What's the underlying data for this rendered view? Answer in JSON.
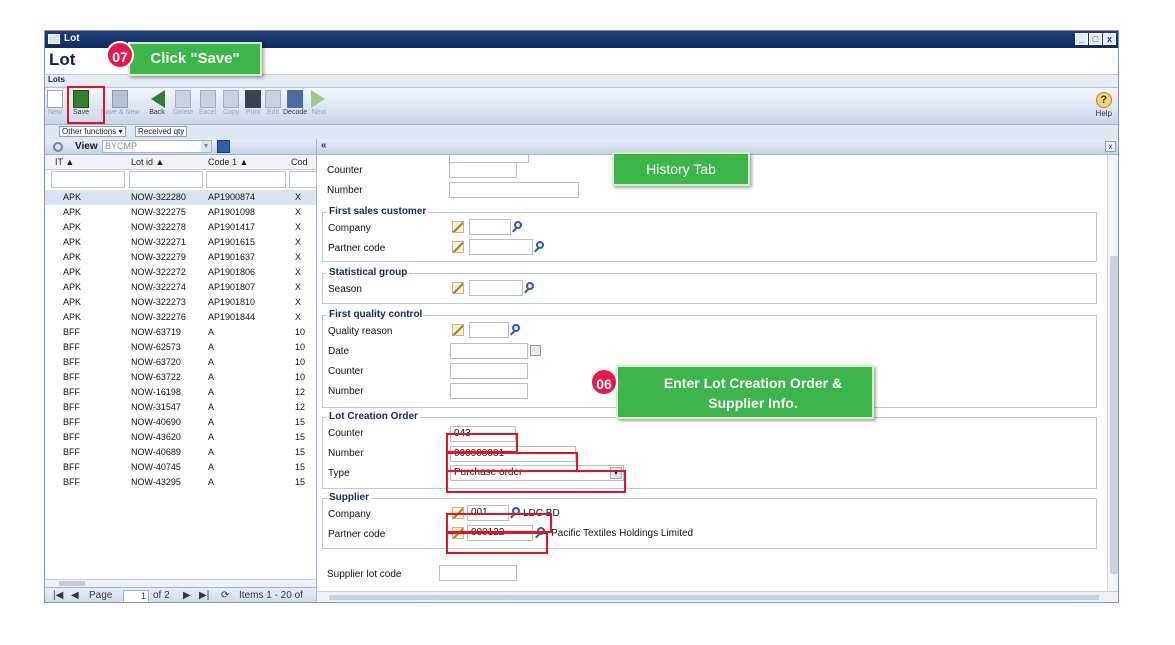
{
  "window": {
    "title": "Lot",
    "header": "Lot",
    "subheader": "Lots",
    "controls": [
      "_",
      "□",
      "x"
    ]
  },
  "toolbar": {
    "new": "New",
    "save": "Save",
    "save_new": "Save & New",
    "back": "Back",
    "delete": "Delete",
    "excel": "Excel",
    "copy": "Copy",
    "print": "Print",
    "edit": "Edit",
    "decode": "Decode",
    "next": "Next",
    "help": "Help"
  },
  "subtoolbar": {
    "other_functions": "Other functions ▾",
    "received_qty": "Received qty"
  },
  "grid": {
    "view_label": "View",
    "view_value": "BYCMP",
    "columns": [
      "IT ▲",
      "Lot id ▲",
      "Code 1 ▲",
      "Cod"
    ],
    "rows": [
      [
        "APK",
        "NOW-322280",
        "AP1900874",
        "X"
      ],
      [
        "APK",
        "NOW-322275",
        "AP1901098",
        "X"
      ],
      [
        "APK",
        "NOW-322278",
        "AP1901417",
        "X"
      ],
      [
        "APK",
        "NOW-322271",
        "AP1901615",
        "X"
      ],
      [
        "APK",
        "NOW-322279",
        "AP1901637",
        "X"
      ],
      [
        "APK",
        "NOW-322272",
        "AP1901806",
        "X"
      ],
      [
        "APK",
        "NOW-322274",
        "AP1901807",
        "X"
      ],
      [
        "APK",
        "NOW-322273",
        "AP1901810",
        "X"
      ],
      [
        "APK",
        "NOW-322276",
        "AP1901844",
        "X"
      ],
      [
        "BFF",
        "NOW-63719",
        "A",
        "10"
      ],
      [
        "BFF",
        "NOW-62573",
        "A",
        "10"
      ],
      [
        "BFF",
        "NOW-63720",
        "A",
        "10"
      ],
      [
        "BFF",
        "NOW-63722",
        "A",
        "10"
      ],
      [
        "BFF",
        "NOW-16198",
        "A",
        "12"
      ],
      [
        "BFF",
        "NOW-31547",
        "A",
        "12"
      ],
      [
        "BFF",
        "NOW-40690",
        "A",
        "15"
      ],
      [
        "BFF",
        "NOW-43620",
        "A",
        "15"
      ],
      [
        "BFF",
        "NOW-40689",
        "A",
        "15"
      ],
      [
        "BFF",
        "NOW-40745",
        "A",
        "15"
      ],
      [
        "BFF",
        "NOW-43295",
        "A",
        "15"
      ]
    ],
    "pager": {
      "page_label": "Page",
      "page_value": "1",
      "of": "of 2",
      "items": "Items 1 - 20 of"
    }
  },
  "form": {
    "top": {
      "counter_label": "Counter",
      "number_label": "Number"
    },
    "first_sales_customer": {
      "legend": "First sales customer",
      "company_label": "Company",
      "partner_label": "Partner code"
    },
    "statistical_group": {
      "legend": "Statistical group",
      "season_label": "Season"
    },
    "first_quality_control": {
      "legend": "First quality control",
      "reason_label": "Quality reason",
      "date_label": "Date",
      "counter_label": "Counter",
      "number_label": "Number"
    },
    "lot_creation_order": {
      "legend": "Lot Creation Order",
      "counter_label": "Counter",
      "counter_value": "043",
      "number_label": "Number",
      "number_value": "000008081",
      "type_label": "Type",
      "type_value": "Purchase order"
    },
    "supplier": {
      "legend": "Supplier",
      "company_label": "Company",
      "company_value": "001",
      "company_name": "LDC BD",
      "partner_label": "Partner code",
      "partner_value": "000122",
      "partner_name": "Pacific Textiles Holdings Limited"
    },
    "supplier_lot_code_label": "Supplier lot code"
  },
  "annotations": {
    "step07_badge": "07",
    "step07_text": "Click \"Save\"",
    "history_tab": "History Tab",
    "step06_badge": "06",
    "step06_text": "Enter Lot Creation Order & Supplier Info."
  },
  "colors": {
    "accent_green": "#3cb54a",
    "badge_pink": "#e8174b",
    "highlight_red": "#e3141e",
    "title_blue": "#0f2b63"
  }
}
